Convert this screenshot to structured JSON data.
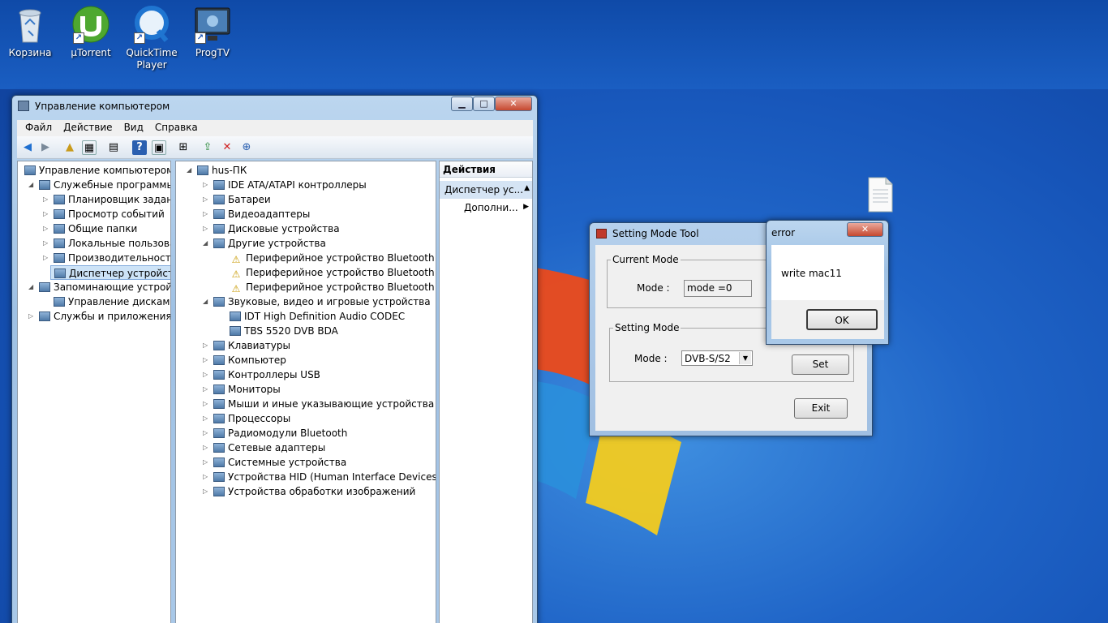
{
  "desktop": {
    "icons": [
      {
        "label": "Корзина"
      },
      {
        "label": "µTorrent"
      },
      {
        "label": "QuickTime Player"
      },
      {
        "label": "ProgTV"
      }
    ]
  },
  "mmc": {
    "title": "Управление компьютером",
    "menu": [
      "Файл",
      "Действие",
      "Вид",
      "Справка"
    ],
    "left_tree": [
      {
        "label": "Управление компьютером (л",
        "level": 0,
        "expand": ""
      },
      {
        "label": "Служебные программы",
        "level": 1,
        "expand": "open"
      },
      {
        "label": "Планировщик заданий",
        "level": 2,
        "expand": "closed"
      },
      {
        "label": "Просмотр событий",
        "level": 2,
        "expand": "closed"
      },
      {
        "label": "Общие папки",
        "level": 2,
        "expand": "closed"
      },
      {
        "label": "Локальные пользовате",
        "level": 2,
        "expand": "closed"
      },
      {
        "label": "Производительность",
        "level": 2,
        "expand": "closed"
      },
      {
        "label": "Диспетчер устройств",
        "level": 2,
        "expand": "",
        "selected": true
      },
      {
        "label": "Запоминающие устройст",
        "level": 1,
        "expand": "open"
      },
      {
        "label": "Управление дисками",
        "level": 2,
        "expand": ""
      },
      {
        "label": "Службы и приложения",
        "level": 1,
        "expand": "closed"
      }
    ],
    "device_tree": [
      {
        "label": "hus-ПК",
        "level": 0,
        "expand": "open"
      },
      {
        "label": "IDE ATA/ATAPI контроллеры",
        "level": 1,
        "expand": "closed"
      },
      {
        "label": "Батареи",
        "level": 1,
        "expand": "closed"
      },
      {
        "label": "Видеоадаптеры",
        "level": 1,
        "expand": "closed"
      },
      {
        "label": "Дисковые устройства",
        "level": 1,
        "expand": "closed"
      },
      {
        "label": "Другие устройства",
        "level": 1,
        "expand": "open"
      },
      {
        "label": "Периферийное устройство Bluetooth",
        "level": 2,
        "expand": "",
        "warn": true
      },
      {
        "label": "Периферийное устройство Bluetooth",
        "level": 2,
        "expand": "",
        "warn": true
      },
      {
        "label": "Периферийное устройство Bluetooth",
        "level": 2,
        "expand": "",
        "warn": true
      },
      {
        "label": "Звуковые, видео и игровые устройства",
        "level": 1,
        "expand": "open"
      },
      {
        "label": "IDT High Definition Audio CODEC",
        "level": 2,
        "expand": ""
      },
      {
        "label": "TBS 5520 DVB BDA",
        "level": 2,
        "expand": ""
      },
      {
        "label": "Клавиатуры",
        "level": 1,
        "expand": "closed"
      },
      {
        "label": "Компьютер",
        "level": 1,
        "expand": "closed"
      },
      {
        "label": "Контроллеры USB",
        "level": 1,
        "expand": "closed"
      },
      {
        "label": "Мониторы",
        "level": 1,
        "expand": "closed"
      },
      {
        "label": "Мыши и иные указывающие устройства",
        "level": 1,
        "expand": "closed"
      },
      {
        "label": "Процессоры",
        "level": 1,
        "expand": "closed"
      },
      {
        "label": "Радиомодули Bluetooth",
        "level": 1,
        "expand": "closed"
      },
      {
        "label": "Сетевые адаптеры",
        "level": 1,
        "expand": "closed"
      },
      {
        "label": "Системные устройства",
        "level": 1,
        "expand": "closed"
      },
      {
        "label": "Устройства HID (Human Interface Devices)",
        "level": 1,
        "expand": "closed"
      },
      {
        "label": "Устройства обработки изображений",
        "level": 1,
        "expand": "closed"
      }
    ],
    "actions": {
      "header": "Действия",
      "section": "Диспетчер ус...",
      "more": "Дополни..."
    }
  },
  "tool": {
    "title": "Setting Mode Tool",
    "current_group": "Current Mode",
    "current_mode_label": "Mode :",
    "current_mode_value": "mode =0",
    "setting_group": "Setting Mode",
    "setting_mode_label": "Mode :",
    "setting_mode_value": "DVB-S/S2",
    "set_button": "Set",
    "exit_button": "Exit"
  },
  "error": {
    "title": "error",
    "message": "write mac11",
    "ok_button": "OK"
  },
  "colors": {
    "desktop_blue": "#1f64c7",
    "window_frame": "#a9c8e8",
    "selection": "#cde3f7"
  }
}
